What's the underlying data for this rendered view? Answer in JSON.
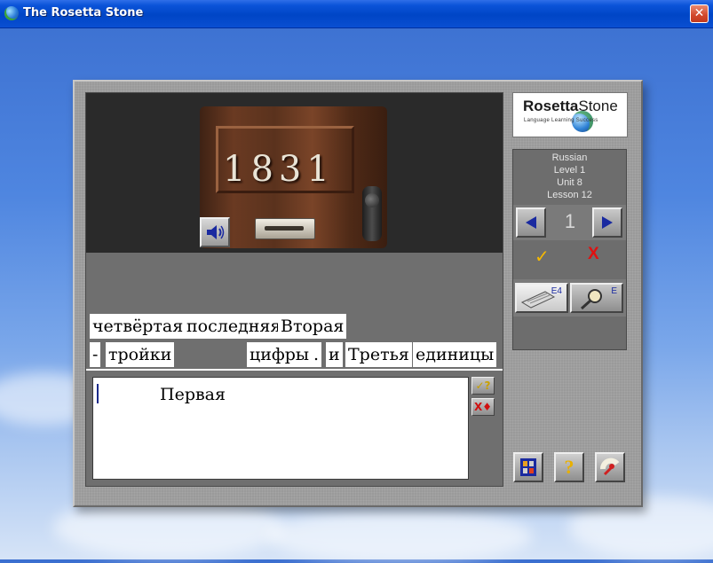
{
  "window": {
    "title": "The Rosetta Stone",
    "close_glyph": "✕"
  },
  "photo": {
    "house_number": "1831",
    "speaker_icon": "speaker-icon"
  },
  "word_bank": {
    "row1": [
      "четвёртая",
      "последняя",
      "Вторая"
    ],
    "row2": [
      "-",
      "тройки",
      "цифры",
      ".",
      "и",
      "Третья",
      "единицы"
    ]
  },
  "answer": {
    "text": "Первая"
  },
  "answer_tools": {
    "check_label": "✓?",
    "clear_label": "X♦"
  },
  "logo": {
    "brand_bold": "Rosetta",
    "brand_rest": "Stone",
    "tagline": "Language Learning    Success"
  },
  "course": {
    "language": "Russian",
    "level": "Level 1",
    "unit": "Unit 8",
    "lesson": "Lesson 12",
    "page": "1"
  },
  "marks": {
    "correct": "✓",
    "wrong": "X"
  },
  "modes": {
    "keyboard_label": "E4",
    "magnifier_label": "E"
  },
  "bottom_buttons": {
    "help_label": "?"
  },
  "colors": {
    "accent_blue": "#1a2aa0",
    "check_yellow": "#f5b800",
    "wrong_red": "#e01010"
  }
}
